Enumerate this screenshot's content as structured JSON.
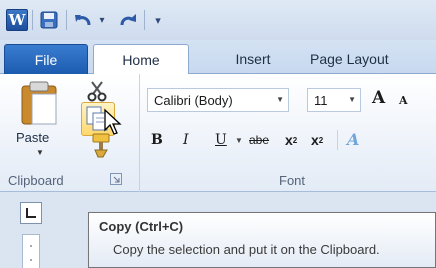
{
  "quick_access": {
    "app_icon": "word-logo-icon",
    "app_letter": "W",
    "save_icon": "save-icon",
    "undo_icon": "undo-icon",
    "redo_icon": "redo-icon",
    "customize_icon": "customize-qat-icon"
  },
  "tabs": [
    {
      "label": "File"
    },
    {
      "label": "Home"
    },
    {
      "label": "Insert"
    },
    {
      "label": "Page Layout"
    }
  ],
  "ribbon": {
    "clipboard": {
      "group_label": "Clipboard",
      "paste_label": "Paste"
    },
    "font": {
      "group_label": "Font",
      "font_name": "Calibri (Body)",
      "font_size": "11",
      "grow_label": "A",
      "shrink_label": "A",
      "bold_label": "B",
      "italic_label": "I",
      "underline_label": "U",
      "strike_label": "abe",
      "sub_label": "x",
      "sup_label": "x",
      "effects_label": "A"
    }
  },
  "tooltip": {
    "title": "Copy (Ctrl+C)",
    "body": "Copy the selection and put it on the Clipboard."
  },
  "colors": {
    "file_tab": "#1c5bb0",
    "tooltip_border": "#767676"
  }
}
